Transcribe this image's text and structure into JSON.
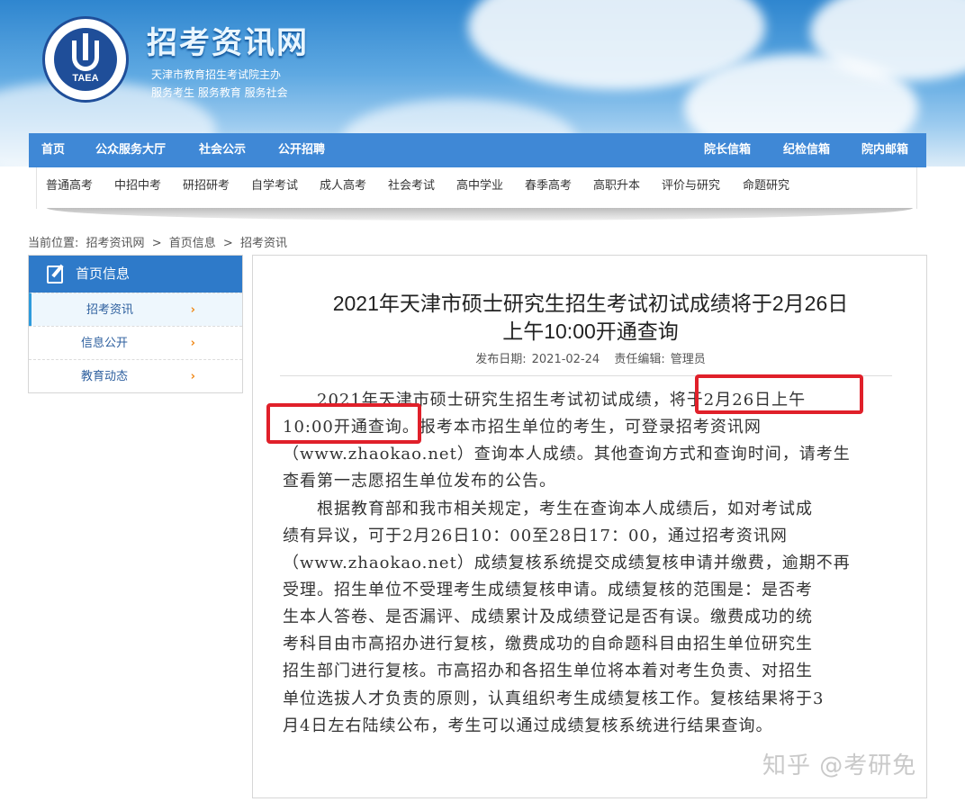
{
  "header": {
    "logo_text": "TAEA",
    "site_title": "招考资讯网",
    "sub_line_1": "天津市教育招生考试院主办",
    "sub_line_2": "服务考生 服务教育 服务社会"
  },
  "nav": {
    "left": [
      "首页",
      "公众服务大厅",
      "社会公示",
      "公开招聘"
    ],
    "right": [
      "院长信箱",
      "纪检信箱",
      "院内邮箱"
    ]
  },
  "sub_nav": [
    "普通高考",
    "中招中考",
    "研招研考",
    "自学考试",
    "成人高考",
    "社会考试",
    "高中学业",
    "春季高考",
    "高职升本",
    "评价与研究",
    "命题研究"
  ],
  "breadcrumb": {
    "prefix": "当前位置:",
    "items": [
      "招考资讯网",
      "首页信息",
      "招考资讯"
    ],
    "separator": ">"
  },
  "sidebar": {
    "title": "首页信息",
    "items": [
      {
        "label": "招考资讯",
        "active": true
      },
      {
        "label": "信息公开",
        "active": false
      },
      {
        "label": "教育动态",
        "active": false
      }
    ],
    "chevron": "›"
  },
  "article": {
    "title_line_1": "2021年天津市硕士研究生招生考试初试成绩将于2月26日",
    "title_line_2": "上午10:00开通查询",
    "date_label": "发布日期:",
    "date": "2021-02-24",
    "editor_label": "责任编辑:",
    "editor": "管理员",
    "lines": [
      "　　2021年天津市硕士研究生招生考试初试成绩，将于2月26日上午",
      "10:00开通查询。报考本市招生单位的考生，可登录招考资讯网",
      "（www.zhaokao.net）查询本人成绩。其他查询方式和查询时间，请考生",
      "查看第一志愿招生单位发布的公告。",
      "　　根据教育部和我市相关规定，考生在查询本人成绩后，如对考试成",
      "绩有异议，可于2月26日10：00至28日17：00，通过招考资讯网",
      "（www.zhaokao.net）成绩复核系统提交成绩复核申请并缴费，逾期不再",
      "受理。招生单位不受理考生成绩复核申请。成绩复核的范围是：是否考",
      "生本人答卷、是否漏评、成绩累计及成绩登记是否有误。缴费成功的统",
      "考科目由市高招办进行复核，缴费成功的自命题科目由招生单位研究生",
      "招生部门进行复核。市高招办和各招生单位将本着对考生负责、对招生",
      "单位选拔人才负责的原则，认真组织考生成绩复核工作。复核结果将于3",
      "月4日左右陆续公布，考生可以通过成绩复核系统进行结果查询。"
    ]
  },
  "watermark": "知乎 @考研免"
}
